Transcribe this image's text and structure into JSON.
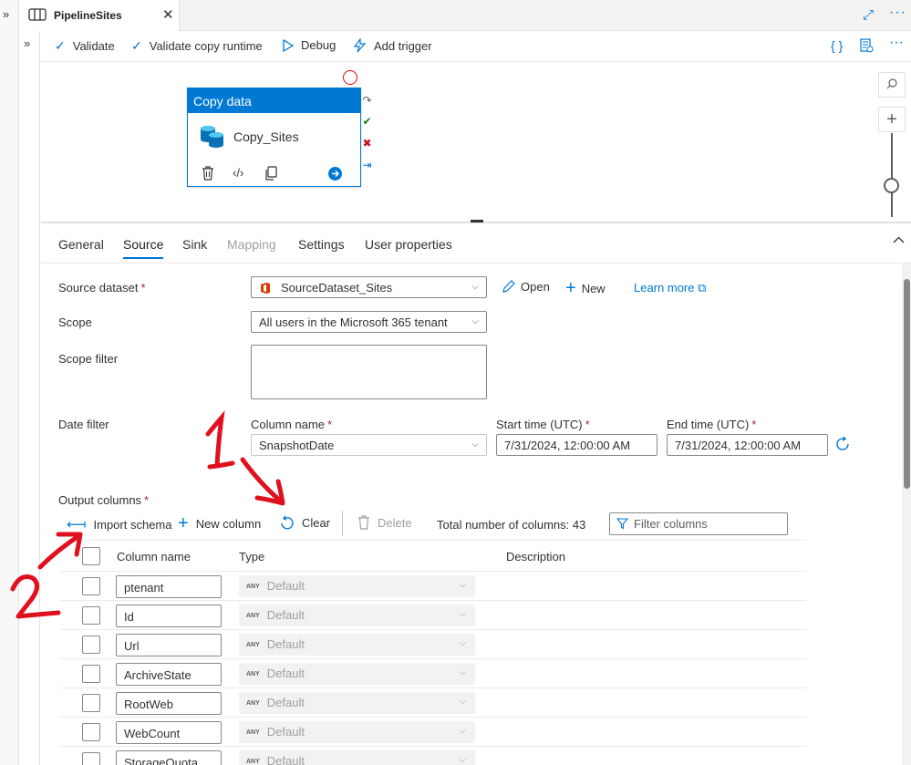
{
  "tab": {
    "title": "PipelineSites"
  },
  "toolbar": {
    "validate": "Validate",
    "validate_copy_runtime": "Validate copy runtime",
    "debug": "Debug",
    "add_trigger": "Add trigger"
  },
  "activity": {
    "header": "Copy data",
    "name": "Copy_Sites"
  },
  "properties": {
    "tabs": [
      "General",
      "Source",
      "Sink",
      "Mapping",
      "Settings",
      "User properties"
    ],
    "source_dataset_label": "Source dataset",
    "source_dataset_value": "SourceDataset_Sites",
    "open": "Open",
    "new": "New",
    "learn_more": "Learn more",
    "scope_label": "Scope",
    "scope_value": "All users in the Microsoft 365 tenant",
    "scope_filter_label": "Scope filter",
    "date_filter_label": "Date filter",
    "column_name_label": "Column name",
    "column_name_value": "SnapshotDate",
    "start_time_label": "Start time (UTC)",
    "start_time_value": "7/31/2024, 12:00:00 AM",
    "end_time_label": "End time (UTC)",
    "end_time_value": "7/31/2024, 12:00:00 AM",
    "required_mark": "*"
  },
  "output_columns": {
    "label": "Output columns",
    "import_schema": "Import schema",
    "new_column": "New column",
    "clear": "Clear",
    "delete": "Delete",
    "total": "Total number of columns: 43",
    "filter_placeholder": "Filter columns",
    "headers": {
      "column_name": "Column name",
      "type": "Type",
      "description": "Description"
    },
    "any_badge": "ANY",
    "default_type": "Default",
    "rows": [
      "ptenant",
      "Id",
      "Url",
      "ArchiveState",
      "RootWeb",
      "WebCount",
      "StorageQuota"
    ]
  },
  "annotations": {
    "one": "1",
    "two": "2"
  },
  "colors": {
    "accent": "#0078d4",
    "annotation": "#e0101e"
  }
}
